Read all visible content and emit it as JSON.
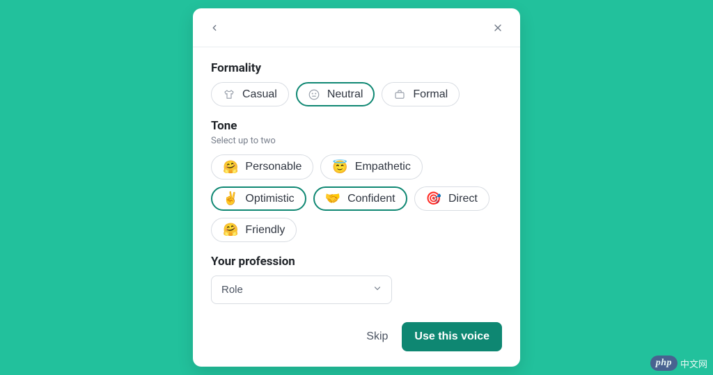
{
  "formality": {
    "title": "Formality",
    "options": [
      {
        "label": "Casual",
        "icon": "tshirt",
        "selected": false
      },
      {
        "label": "Neutral",
        "icon": "neutral",
        "selected": true
      },
      {
        "label": "Formal",
        "icon": "brief",
        "selected": false
      }
    ]
  },
  "tone": {
    "title": "Tone",
    "subtitle": "Select up to two",
    "options": [
      {
        "label": "Personable",
        "emoji": "🤗",
        "selected": false
      },
      {
        "label": "Empathetic",
        "emoji": "😇",
        "selected": false
      },
      {
        "label": "Optimistic",
        "emoji": "✌️",
        "selected": true
      },
      {
        "label": "Confident",
        "emoji": "🤝",
        "selected": true
      },
      {
        "label": "Direct",
        "emoji": "🎯",
        "selected": false
      },
      {
        "label": "Friendly",
        "emoji": "🤗",
        "selected": false
      }
    ]
  },
  "profession": {
    "title": "Your profession",
    "placeholder": "Role"
  },
  "footer": {
    "skip": "Skip",
    "primary": "Use this voice"
  },
  "watermark": {
    "badge": "php",
    "text": "中文网"
  }
}
